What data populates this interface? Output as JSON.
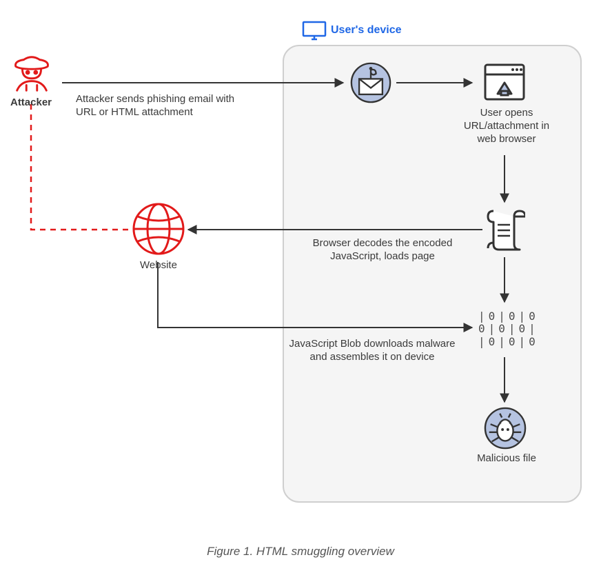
{
  "header": {
    "user_device_label": "User's device"
  },
  "nodes": {
    "attacker": {
      "label": "Attacker"
    },
    "email": {
      "label": ""
    },
    "browser": {
      "label": "User opens URL/attachment in web browser"
    },
    "script": {
      "label": ""
    },
    "website": {
      "label": "Website"
    },
    "binary": {
      "line1": "|0|0|0",
      "line2": "0|0|0|",
      "line3": "|0|0|0"
    },
    "malicious": {
      "label": "Malicious file"
    }
  },
  "edges": {
    "attacker_to_email": "Attacker sends phishing email with URL or HTML attachment",
    "script_to_website": "Browser decodes the encoded JavaScript, loads page",
    "website_to_binary": "JavaScript Blob downloads malware and assembles it on device"
  },
  "caption": "Figure 1. HTML smuggling overview",
  "colors": {
    "attacker": "#e21a1a",
    "accent_blue": "#1f67e6",
    "icon_fill": "#b5c3e1",
    "stroke_dark": "#333333",
    "box_border": "#cfcfcf",
    "box_fill": "#f5f5f5"
  }
}
